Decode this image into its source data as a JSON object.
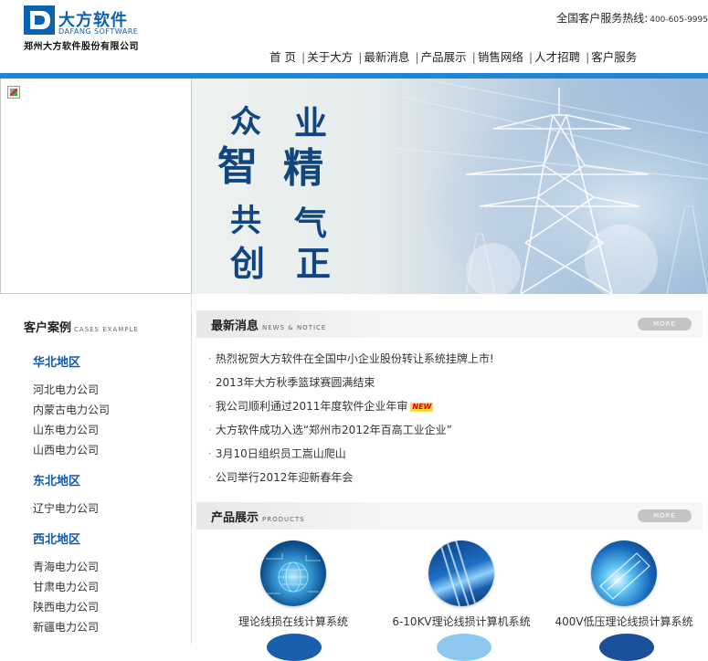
{
  "header": {
    "logo_cn": "大方软件",
    "logo_en": "DAFANG SOFTWARE",
    "company": "郑州大方软件股份有限公司",
    "hotline_label": "全国客户服务热线:",
    "hotline_number": "400-605-9995"
  },
  "nav": {
    "items": [
      "首 页",
      "关于大方",
      "最新消息",
      "产品展示",
      "销售网络",
      "人才招聘",
      "客户服务"
    ],
    "separator": "|"
  },
  "banner": {
    "slogan": [
      "众",
      "智",
      "共",
      "创",
      "业",
      "精",
      "气",
      "正"
    ]
  },
  "cases": {
    "title": "客户案例",
    "title_en": "CASES EXAMPLE",
    "regions": [
      {
        "name": "华北地区",
        "companies": [
          "河北电力公司",
          "内蒙古电力公司",
          "山东电力公司",
          "山西电力公司"
        ]
      },
      {
        "name": "东北地区",
        "companies": [
          "辽宁电力公司"
        ]
      },
      {
        "name": "西北地区",
        "companies": [
          "青海电力公司",
          "甘肃电力公司",
          "陕西电力公司",
          "新疆电力公司"
        ]
      }
    ]
  },
  "news": {
    "title": "最新消息",
    "title_en": "NEWS & NOTICE",
    "more": "MORE",
    "bullet": "·",
    "new_badge": "NEW",
    "items": [
      "热烈祝贺大方软件在全国中小企业股份转让系统挂牌上市!",
      "2013年大方秋季篮球赛圆满结束",
      "我公司顺利通过2011年度软件企业年审",
      "大方软件成功入选“郑州市2012年百高工业企业”",
      "3月10日组织员工嵩山爬山",
      "公司举行2012年迎新春年会"
    ]
  },
  "products": {
    "title": "产品展示",
    "title_en": "PRODUCTS",
    "more": "MORE",
    "items": [
      "理论线损在线计算系统",
      "6-10KV理论线损计算机系统",
      "400V低压理论线损计算系统"
    ]
  },
  "colors": {
    "brand_blue": "#1e86d6",
    "region_blue": "#0f5aa3",
    "slogan_blue": "#11457f"
  }
}
